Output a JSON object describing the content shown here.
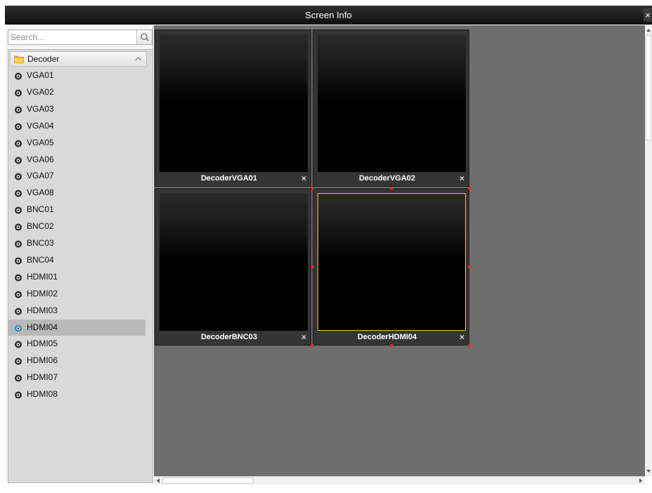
{
  "window": {
    "title": "Screen Info",
    "close_glyph": "×"
  },
  "sidebar": {
    "search": {
      "placeholder": "Search...",
      "icon": "search-icon"
    },
    "group": {
      "label": "Decoder",
      "icon": "folder-icon",
      "toggle_icon": "chevron-up-icon"
    },
    "items": [
      {
        "label": "VGA01"
      },
      {
        "label": "VGA02"
      },
      {
        "label": "VGA03"
      },
      {
        "label": "VGA04"
      },
      {
        "label": "VGA05"
      },
      {
        "label": "VGA06"
      },
      {
        "label": "VGA07"
      },
      {
        "label": "VGA08"
      },
      {
        "label": "BNC01"
      },
      {
        "label": "BNC02"
      },
      {
        "label": "BNC03"
      },
      {
        "label": "BNC04"
      },
      {
        "label": "HDMI01"
      },
      {
        "label": "HDMI02"
      },
      {
        "label": "HDMI03"
      },
      {
        "label": "HDMI04"
      },
      {
        "label": "HDMI05"
      },
      {
        "label": "HDMI06"
      },
      {
        "label": "HDMI07"
      },
      {
        "label": "HDMI08"
      }
    ],
    "selected_item": "HDMI04"
  },
  "screens": [
    {
      "label": "DecoderVGA01",
      "close_glyph": "×",
      "active": false
    },
    {
      "label": "DecoderVGA02",
      "close_glyph": "×",
      "active": false
    },
    {
      "label": "DecoderBNC03",
      "close_glyph": "×",
      "active": false
    },
    {
      "label": "DecoderHDMI04",
      "close_glyph": "×",
      "active": true
    }
  ],
  "colors": {
    "title_bar": "#1a1a1a",
    "workspace": "#6e6e6e",
    "selection_border": "#e6c84a",
    "resize_handle": "#e0282a",
    "selected_row": "#b9b9b9"
  }
}
